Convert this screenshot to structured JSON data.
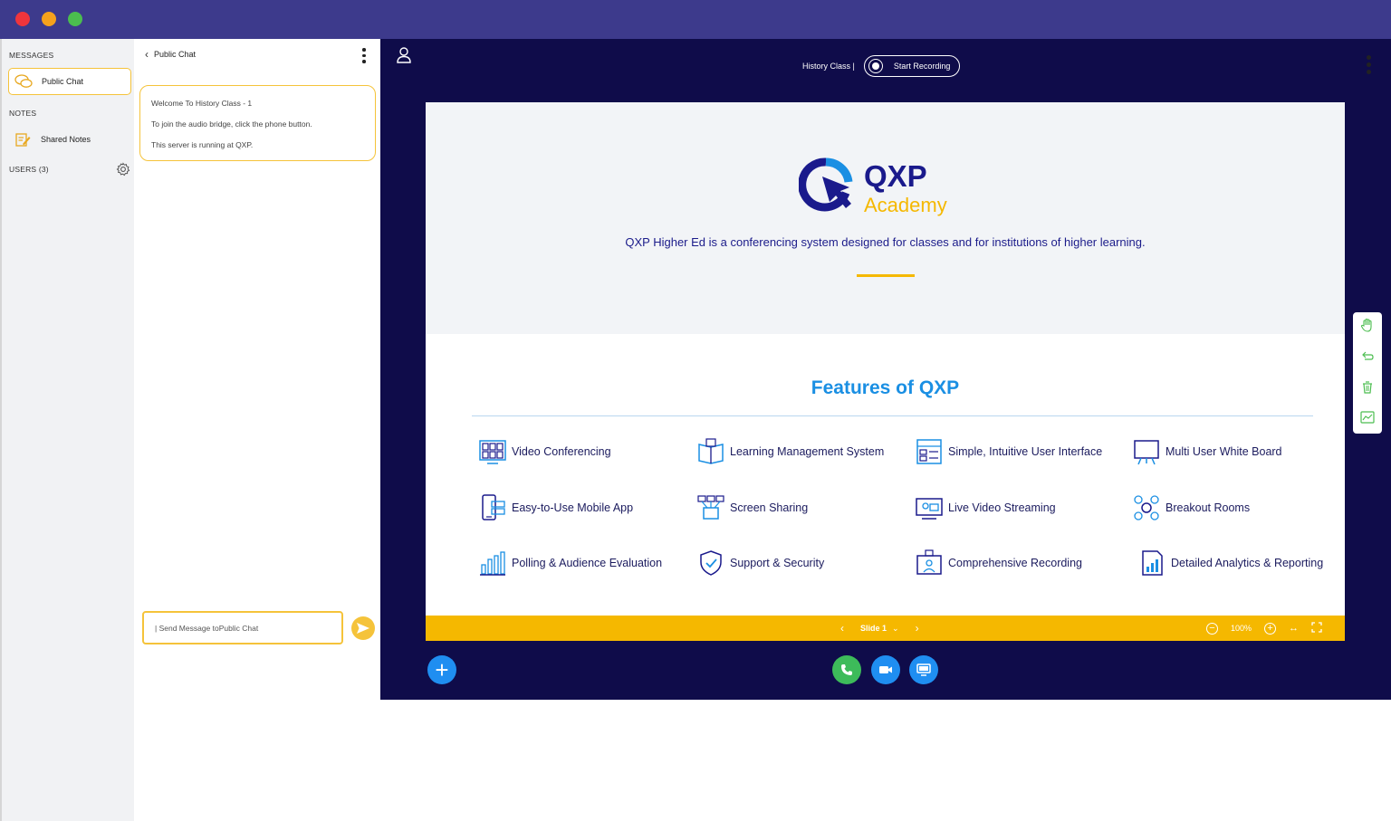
{
  "window": {
    "traffic_lights": [
      "close",
      "minimize",
      "zoom"
    ],
    "colors": {
      "titlebar": "#3d3a8c",
      "accent": "#f5c33a",
      "stage": "#0f0c4a",
      "primary": "#1f8ef1"
    }
  },
  "sidebar": {
    "messages_heading": "MESSAGES",
    "public_chat": "Public Chat",
    "notes_heading": "NOTES",
    "shared_notes": "Shared Notes",
    "users_heading": "USERS (3)"
  },
  "chat": {
    "title": "Public Chat",
    "welcome": {
      "line1": "Welcome To History Class - 1",
      "line2": "To join the audio bridge, click the phone button.",
      "line3": "This server is running at QXP."
    },
    "input_placeholder": "| Send Message toPublic Chat"
  },
  "stage": {
    "class_label": "History Class |",
    "record_label": "Start Recording"
  },
  "slide": {
    "tagline": "QXP Higher Ed is a conferencing system designed for classes and for  institutions of higher learning.",
    "features_title": "Features of QXP",
    "features": [
      "Video Conferencing",
      "Learning Management System",
      "Simple, Intuitive User Interface",
      "Multi User White Board",
      "Easy-to-Use Mobile App",
      "Screen Sharing",
      "Live Video Streaming",
      "Breakout Rooms",
      "Polling & Audience Evaluation",
      "Support & Security",
      "Comprehensive Recording",
      "Detailed Analytics & Reporting"
    ],
    "logo_text": "QXP",
    "logo_sub": "Academy"
  },
  "presentation_bar": {
    "slide_label": "Slide 1",
    "zoom": "100%"
  }
}
